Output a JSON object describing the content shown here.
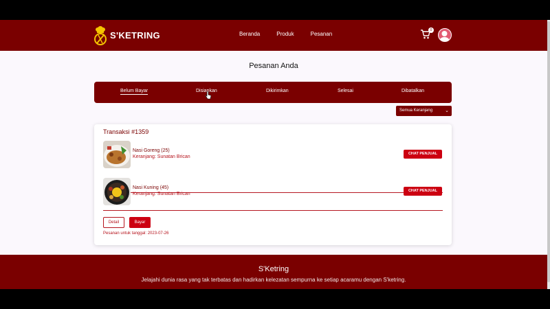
{
  "header": {
    "brand": "S'KETRING",
    "nav": [
      "Beranda",
      "Produk",
      "Pesanan"
    ],
    "cart_count": "0"
  },
  "page": {
    "title": "Pesanan Anda"
  },
  "tabs": [
    "Belum Bayar",
    "Disiapkan",
    "Dikirimkan",
    "Selesai",
    "Dibatalkan"
  ],
  "active_tab": "Belum Bayar",
  "filter": {
    "selected": "Semua Keranjang"
  },
  "transaction": {
    "title": "Transaksi #1359",
    "items": [
      {
        "name": "Nasi Goreng (25)",
        "cart": "Keranjang: Sunatan Brican",
        "chat_label": "CHAT PENJUAL"
      },
      {
        "name": "Nasi Kuning (45)",
        "cart": "Keranjang: Sunatan Brican",
        "chat_label": "CHAT PENJUAL"
      }
    ],
    "detail_label": "Detail",
    "pay_label": "Bayar",
    "order_date": "Pesanan untuk tanggal: 2023-07-26"
  },
  "footer": {
    "title": "S'Ketring",
    "description": "Jelajahi dunia rasa yang tak terbatas dan hadirkan kelezatan sempurna ke setiap acaramu dengan S'ketring."
  },
  "colors": {
    "brand": "#7a0000",
    "accent": "#cc0011",
    "background": "#fbf8fd"
  }
}
